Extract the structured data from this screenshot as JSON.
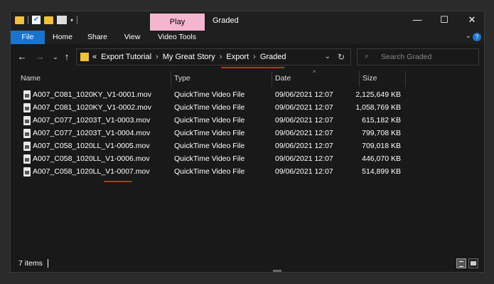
{
  "window": {
    "title": "Graded",
    "context_tab": "Play"
  },
  "ribbon": {
    "tabs": [
      "File",
      "Home",
      "Share",
      "View",
      "Video Tools"
    ]
  },
  "address": {
    "prefix": "«",
    "crumbs": [
      "Export Tutorial",
      "My Great Story",
      "Export",
      "Graded"
    ],
    "separator": "›"
  },
  "search": {
    "placeholder": "Search Graded"
  },
  "columns": {
    "name": "Name",
    "type": "Type",
    "date": "Date",
    "size": "Size"
  },
  "files": [
    {
      "name": "A007_C081_1020KY_V1-0001.mov",
      "type": "QuickTime Video File",
      "date": "09/06/2021 12:07",
      "size": "2,125,649 KB"
    },
    {
      "name": "A007_C081_1020KY_V1-0002.mov",
      "type": "QuickTime Video File",
      "date": "09/06/2021 12:07",
      "size": "1,058,769 KB"
    },
    {
      "name": "A007_C077_10203T_V1-0003.mov",
      "type": "QuickTime Video File",
      "date": "09/06/2021 12:07",
      "size": "615,182 KB"
    },
    {
      "name": "A007_C077_10203T_V1-0004.mov",
      "type": "QuickTime Video File",
      "date": "09/06/2021 12:07",
      "size": "799,708 KB"
    },
    {
      "name": "A007_C058_1020LL_V1-0005.mov",
      "type": "QuickTime Video File",
      "date": "09/06/2021 12:07",
      "size": "709,018 KB"
    },
    {
      "name": "A007_C058_1020LL_V1-0006.mov",
      "type": "QuickTime Video File",
      "date": "09/06/2021 12:07",
      "size": "446,070 KB"
    },
    {
      "name": "A007_C058_1020LL_V1-0007.mov",
      "type": "QuickTime Video File",
      "date": "09/06/2021 12:07",
      "size": "514,899 KB"
    }
  ],
  "status": {
    "count": "7 items"
  },
  "colors": {
    "accent": "#1a73cc",
    "highlight": "#e02020",
    "context_tab": "#f4b6cf"
  }
}
